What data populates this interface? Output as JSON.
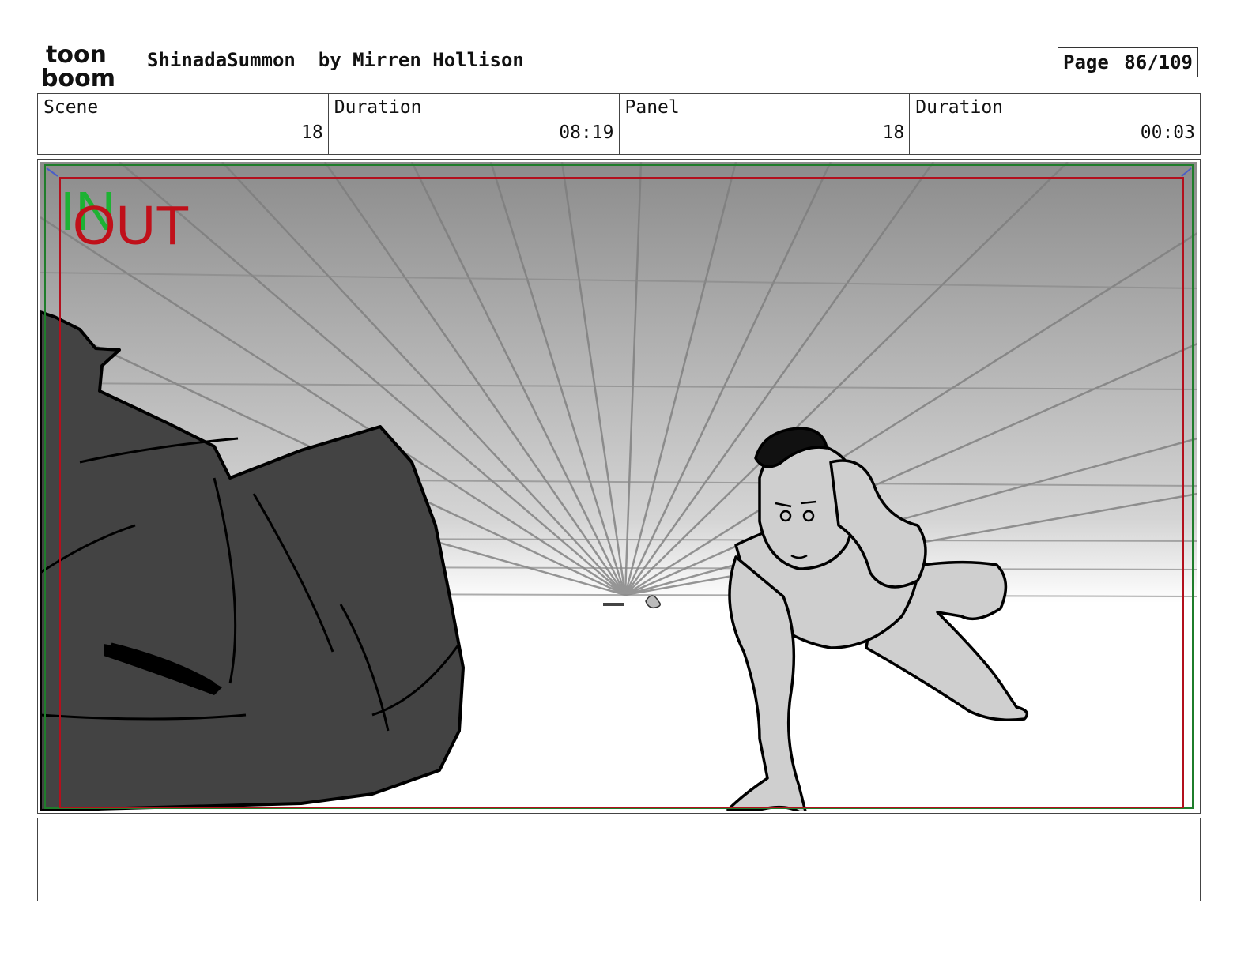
{
  "header": {
    "logo_line1": "toon",
    "logo_line2": "boom",
    "project": "ShinadaSummon",
    "author_prefix": "by",
    "author": "Mirren Hollison",
    "page_label": "Page",
    "page_value": "86/109"
  },
  "info": {
    "scene_label": "Scene",
    "scene_value": "18",
    "scene_duration_label": "Duration",
    "scene_duration_value": "08:19",
    "panel_label": "Panel",
    "panel_value": "18",
    "panel_duration_label": "Duration",
    "panel_duration_value": "00:03"
  },
  "frame_labels": {
    "in": "IN",
    "out": "OUT"
  },
  "colors": {
    "in_green": "#1db233",
    "out_red": "#c0101a"
  },
  "notes": {
    "text": ""
  }
}
